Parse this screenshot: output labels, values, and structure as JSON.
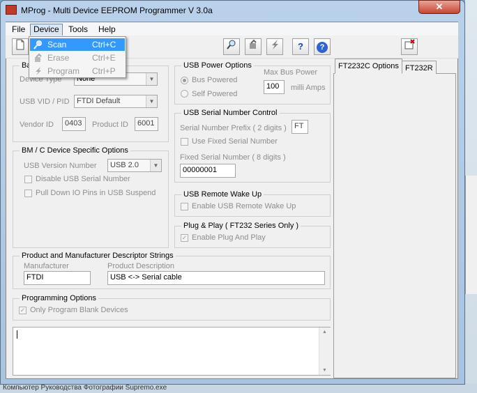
{
  "window": {
    "title": "MProg - Multi Device EEPROM Programmer V 3.0a",
    "close_glyph": "✕"
  },
  "menu": {
    "file": "File",
    "device": "Device",
    "tools": "Tools",
    "help": "Help"
  },
  "device_menu": {
    "items": [
      {
        "label": "Scan",
        "shortcut": "Ctrl+C",
        "icon": "magnifier-icon",
        "enabled": true,
        "highlighted": true
      },
      {
        "label": "Erase",
        "shortcut": "Ctrl+E",
        "icon": "eraser-icon",
        "enabled": false
      },
      {
        "label": "Program",
        "shortcut": "Ctrl+P",
        "icon": "lightning-icon",
        "enabled": false
      }
    ]
  },
  "toolbar": {
    "icons": [
      "new-document-icon",
      "search-icon",
      "erase-icon",
      "program-icon",
      "help-icon",
      "about-icon",
      "close-file-icon"
    ],
    "help_glyph": "?",
    "about_glyph": "?"
  },
  "basic": {
    "title_partial": "Ba",
    "device_type_label": "Device Type",
    "device_type_value": "None",
    "vidpid_label": "USB VID / PID",
    "vidpid_value": "FTDI Default",
    "vendor_label": "Vendor ID",
    "vendor_value": "0403",
    "product_label": "Product ID",
    "product_value": "6001"
  },
  "bmc": {
    "title": "BM / C Device Specific Options",
    "usb_version_label": "USB Version Number",
    "usb_version_value": "USB 2.0",
    "disable_serial": "Disable USB Serial Number",
    "pull_down": "Pull Down IO Pins in USB Suspend"
  },
  "power": {
    "title": "USB Power Options",
    "bus_powered": "Bus Powered",
    "self_powered": "Self Powered",
    "max_bus_label": "Max Bus Power",
    "max_bus_value": "100",
    "milli_amps": "milli Amps"
  },
  "serial": {
    "title": "USB Serial Number Control",
    "prefix_label": "Serial Number Prefix ( 2 digits )",
    "prefix_value": "FT",
    "use_fixed": "Use Fixed Serial Number",
    "fixed_label": "Fixed Serial Number ( 8 digits )",
    "fixed_value": "00000001"
  },
  "wake": {
    "title": "USB Remote Wake Up",
    "enable": "Enable USB Remote Wake Up"
  },
  "pnp": {
    "title": "Plug & Play  ( FT232 Series Only )",
    "enable": "Enable Plug And Play",
    "check_glyph": "✓"
  },
  "descriptors": {
    "title": "Product and Manufacturer Descriptor Strings",
    "manufacturer_label": "Manufacturer",
    "manufacturer_value": "FTDI",
    "product_label": "Product Description",
    "product_value": "USB <-> Serial cable"
  },
  "programming": {
    "title": "Programming Options",
    "only_blank": "Only Program Blank Devices"
  },
  "tabs": [
    "FT2232C Options",
    "FT232R"
  ],
  "taskbar_text": "Компьютер  Руководства  Фотографии  Supremo.exe",
  "colors": {
    "highlight": "#3399ff",
    "disabled_text": "#8d8d8d"
  }
}
